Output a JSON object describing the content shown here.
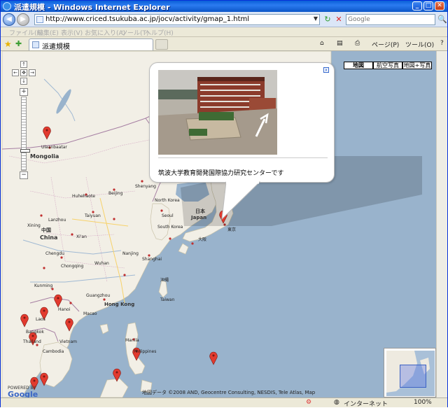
{
  "window": {
    "title": "派遣規模 - Windows Internet Explorer",
    "min": "_",
    "max": "□",
    "close": "✕"
  },
  "address": {
    "url": "http://www.criced.tsukuba.ac.jp/jocv/activity/gmap_1.html",
    "back": "◀",
    "forward": "▶",
    "refresh": "↻",
    "stop": "✕",
    "search_placeholder": "Google",
    "search_icon": "🔍"
  },
  "menu": [
    "ファイル(F)",
    "編集(E)",
    "表示(V)",
    "お気に入り(A)",
    "ツール(T)",
    "ヘルプ(H)"
  ],
  "tab": {
    "label": "派遣規模"
  },
  "commands": {
    "home": "⌂",
    "feeds": "▤",
    "print": "⎙",
    "page": "ページ(P)",
    "tools": "ツール(O)",
    "help": "?"
  },
  "map": {
    "pan_up": "↑",
    "pan_left": "←",
    "pan_center": "✥",
    "pan_right": "→",
    "pan_down": "↓",
    "zoom_in": "+",
    "zoom_out": "−",
    "zoom_level": 0.74,
    "types": [
      "地図",
      "航空写真",
      "地図+写真"
    ],
    "active_type": "地図",
    "info_text": "筑波大学教育開発国際協力研究センターです",
    "info_close": "x",
    "copyright": "地図データ ©2008 AND, Geocentre Consulting, NESDIS, Tele Atlas, Map",
    "powered_by": "POWERED BY",
    "google": "Google",
    "labels": [
      {
        "id": "mongolia",
        "text": "Mongolia",
        "kind": "big"
      },
      {
        "id": "ulaanbaatar",
        "text": "Ulaanbaatar",
        "kind": "small"
      },
      {
        "id": "china",
        "text": "China",
        "kind": "big"
      },
      {
        "id": "china-jp",
        "text": "中国",
        "kind": "mid"
      },
      {
        "id": "japan",
        "text": "Japan",
        "kind": "mid"
      },
      {
        "id": "japan-jp",
        "text": "日本",
        "kind": "mid"
      },
      {
        "id": "north-korea",
        "text": "North Korea",
        "kind": "small"
      },
      {
        "id": "south-korea",
        "text": "South Korea",
        "kind": "small"
      },
      {
        "id": "beijing",
        "text": "Beijing",
        "kind": "small"
      },
      {
        "id": "shenyang",
        "text": "Shenyang",
        "kind": "small"
      },
      {
        "id": "seoul",
        "text": "Seoul",
        "kind": "small"
      },
      {
        "id": "tokyo",
        "text": "東京",
        "kind": "small"
      },
      {
        "id": "osaka",
        "text": "大阪",
        "kind": "small"
      },
      {
        "id": "shanghai",
        "text": "Shanghai",
        "kind": "small"
      },
      {
        "id": "taiwan",
        "text": "Taiwan",
        "kind": "small"
      },
      {
        "id": "hongkong",
        "text": "Hong Kong",
        "kind": "mid"
      },
      {
        "id": "vietnam",
        "text": "Vietnam",
        "kind": "small"
      },
      {
        "id": "laos",
        "text": "Laos",
        "kind": "small"
      },
      {
        "id": "thailand",
        "text": "Thailand",
        "kind": "small"
      },
      {
        "id": "cambodia",
        "text": "Cambodia",
        "kind": "small"
      },
      {
        "id": "philippines",
        "text": "Philippines",
        "kind": "small"
      },
      {
        "id": "manila",
        "text": "Manila",
        "kind": "small"
      },
      {
        "id": "hanoi",
        "text": "Hanoi",
        "kind": "small"
      },
      {
        "id": "bangkok",
        "text": "Bangkok",
        "kind": "small"
      },
      {
        "id": "chongqing",
        "text": "Chongqing",
        "kind": "small"
      },
      {
        "id": "wuhan",
        "text": "Wuhan",
        "kind": "small"
      },
      {
        "id": "nanjing",
        "text": "Nanjing",
        "kind": "small"
      },
      {
        "id": "xian",
        "text": "Xi'an",
        "kind": "small"
      },
      {
        "id": "kunming",
        "text": "Kunming",
        "kind": "small"
      },
      {
        "id": "guangzhou",
        "text": "Guangzhou",
        "kind": "small"
      },
      {
        "id": "hohhot",
        "text": "Huhehaote",
        "kind": "small"
      },
      {
        "id": "taiyuan",
        "text": "Taiyuan",
        "kind": "small"
      },
      {
        "id": "lanzhou",
        "text": "Lanzhou",
        "kind": "small"
      },
      {
        "id": "chengdu",
        "text": "Chengdu",
        "kind": "small"
      },
      {
        "id": "xining",
        "text": "Xining",
        "kind": "small"
      },
      {
        "id": "macao",
        "text": "Macao",
        "kind": "small"
      },
      {
        "id": "okinawa",
        "text": "沖縄",
        "kind": "small"
      }
    ],
    "markers_count": 13
  },
  "status": {
    "zone": "インターネット",
    "zoom": "100%"
  }
}
